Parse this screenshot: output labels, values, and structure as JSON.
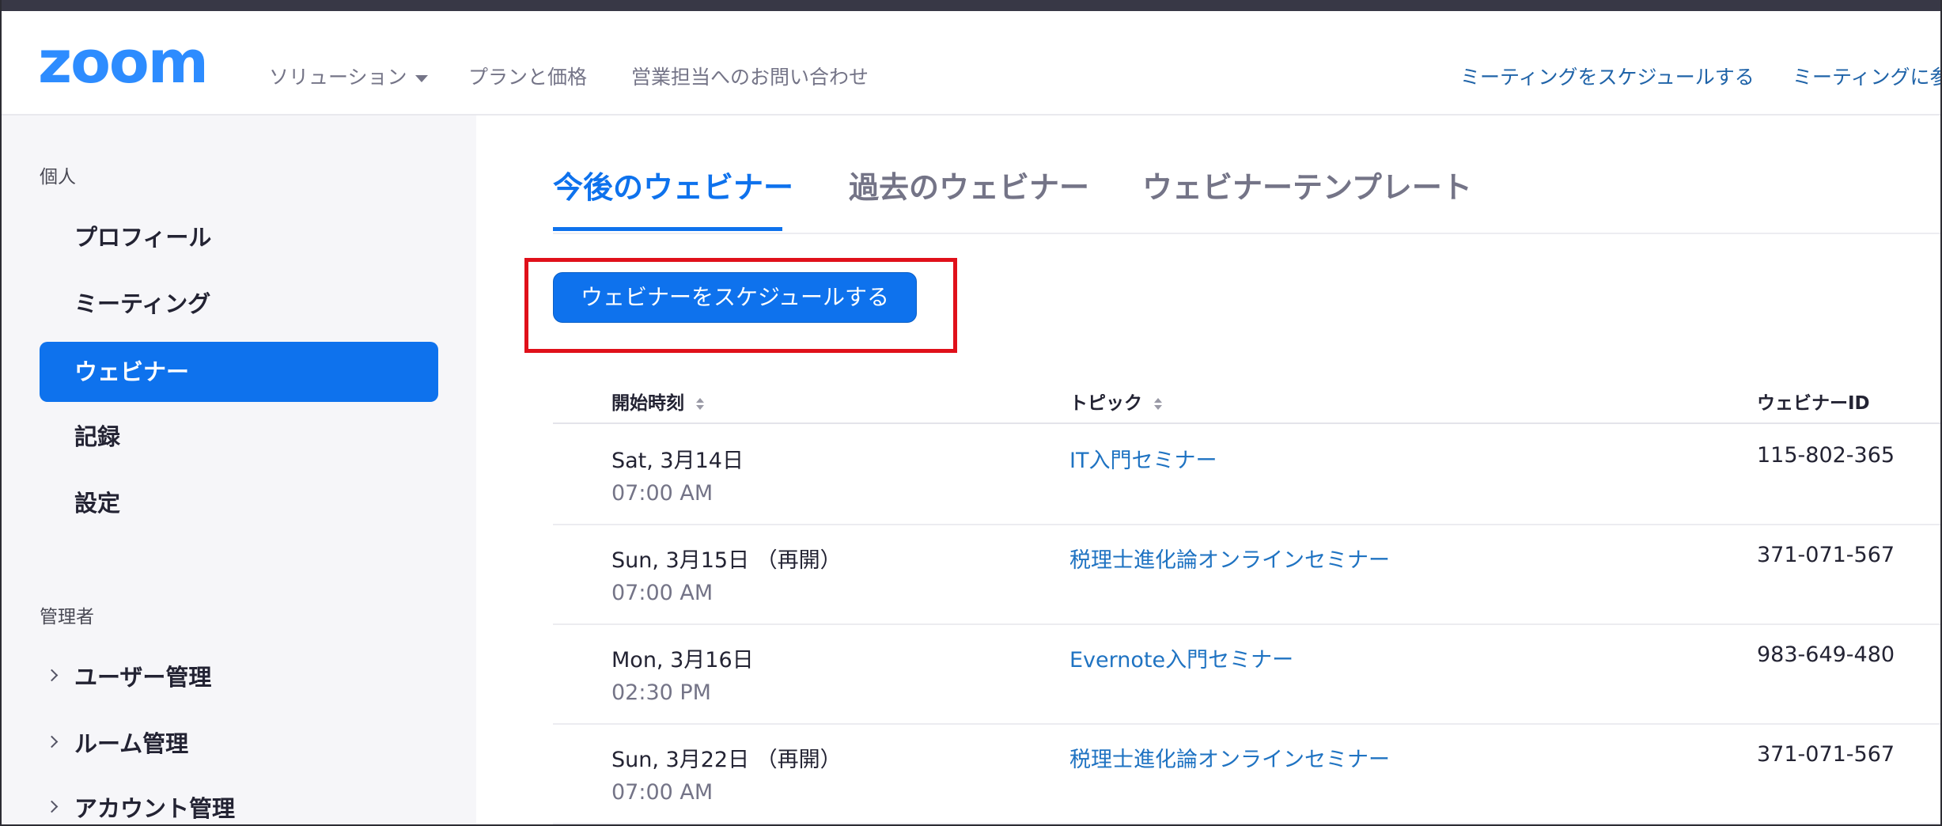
{
  "header": {
    "logo_text": "zoom",
    "nav": [
      "ソリューション",
      "プランと価格",
      "営業担当へのお問い合わせ"
    ],
    "links": [
      "ミーティングをスケジュールする",
      "ミーティングに参"
    ]
  },
  "sidebar": {
    "personal_label": "個人",
    "personal_items": [
      "プロフィール",
      "ミーティング",
      "ウェビナー",
      "記録",
      "設定"
    ],
    "admin_label": "管理者",
    "admin_items": [
      "ユーザー管理",
      "ルーム管理",
      "アカウント管理"
    ]
  },
  "tabs": [
    "今後のウェビナー",
    "過去のウェビナー",
    "ウェビナーテンプレート"
  ],
  "schedule_button": "ウェビナーをスケジュールする",
  "table": {
    "headers": [
      "開始時刻",
      "トピック",
      "ウェビナーID"
    ],
    "rows": [
      {
        "date": "Sat, 3月14日",
        "time": "07:00 AM",
        "topic": "IT入門セミナー",
        "id": "115-802-365"
      },
      {
        "date": "Sun, 3月15日 （再開）",
        "time": "07:00 AM",
        "topic": "税理士進化論オンラインセミナー",
        "id": "371-071-567"
      },
      {
        "date": "Mon, 3月16日",
        "time": "02:30 PM",
        "topic": "Evernote入門セミナー",
        "id": "983-649-480"
      },
      {
        "date": "Sun, 3月22日 （再開）",
        "time": "07:00 AM",
        "topic": "税理士進化論オンラインセミナー",
        "id": "371-071-567"
      }
    ]
  },
  "colors": {
    "brand": "#0e72ed",
    "link": "#1f73c2",
    "highlight": "#e0101a"
  }
}
